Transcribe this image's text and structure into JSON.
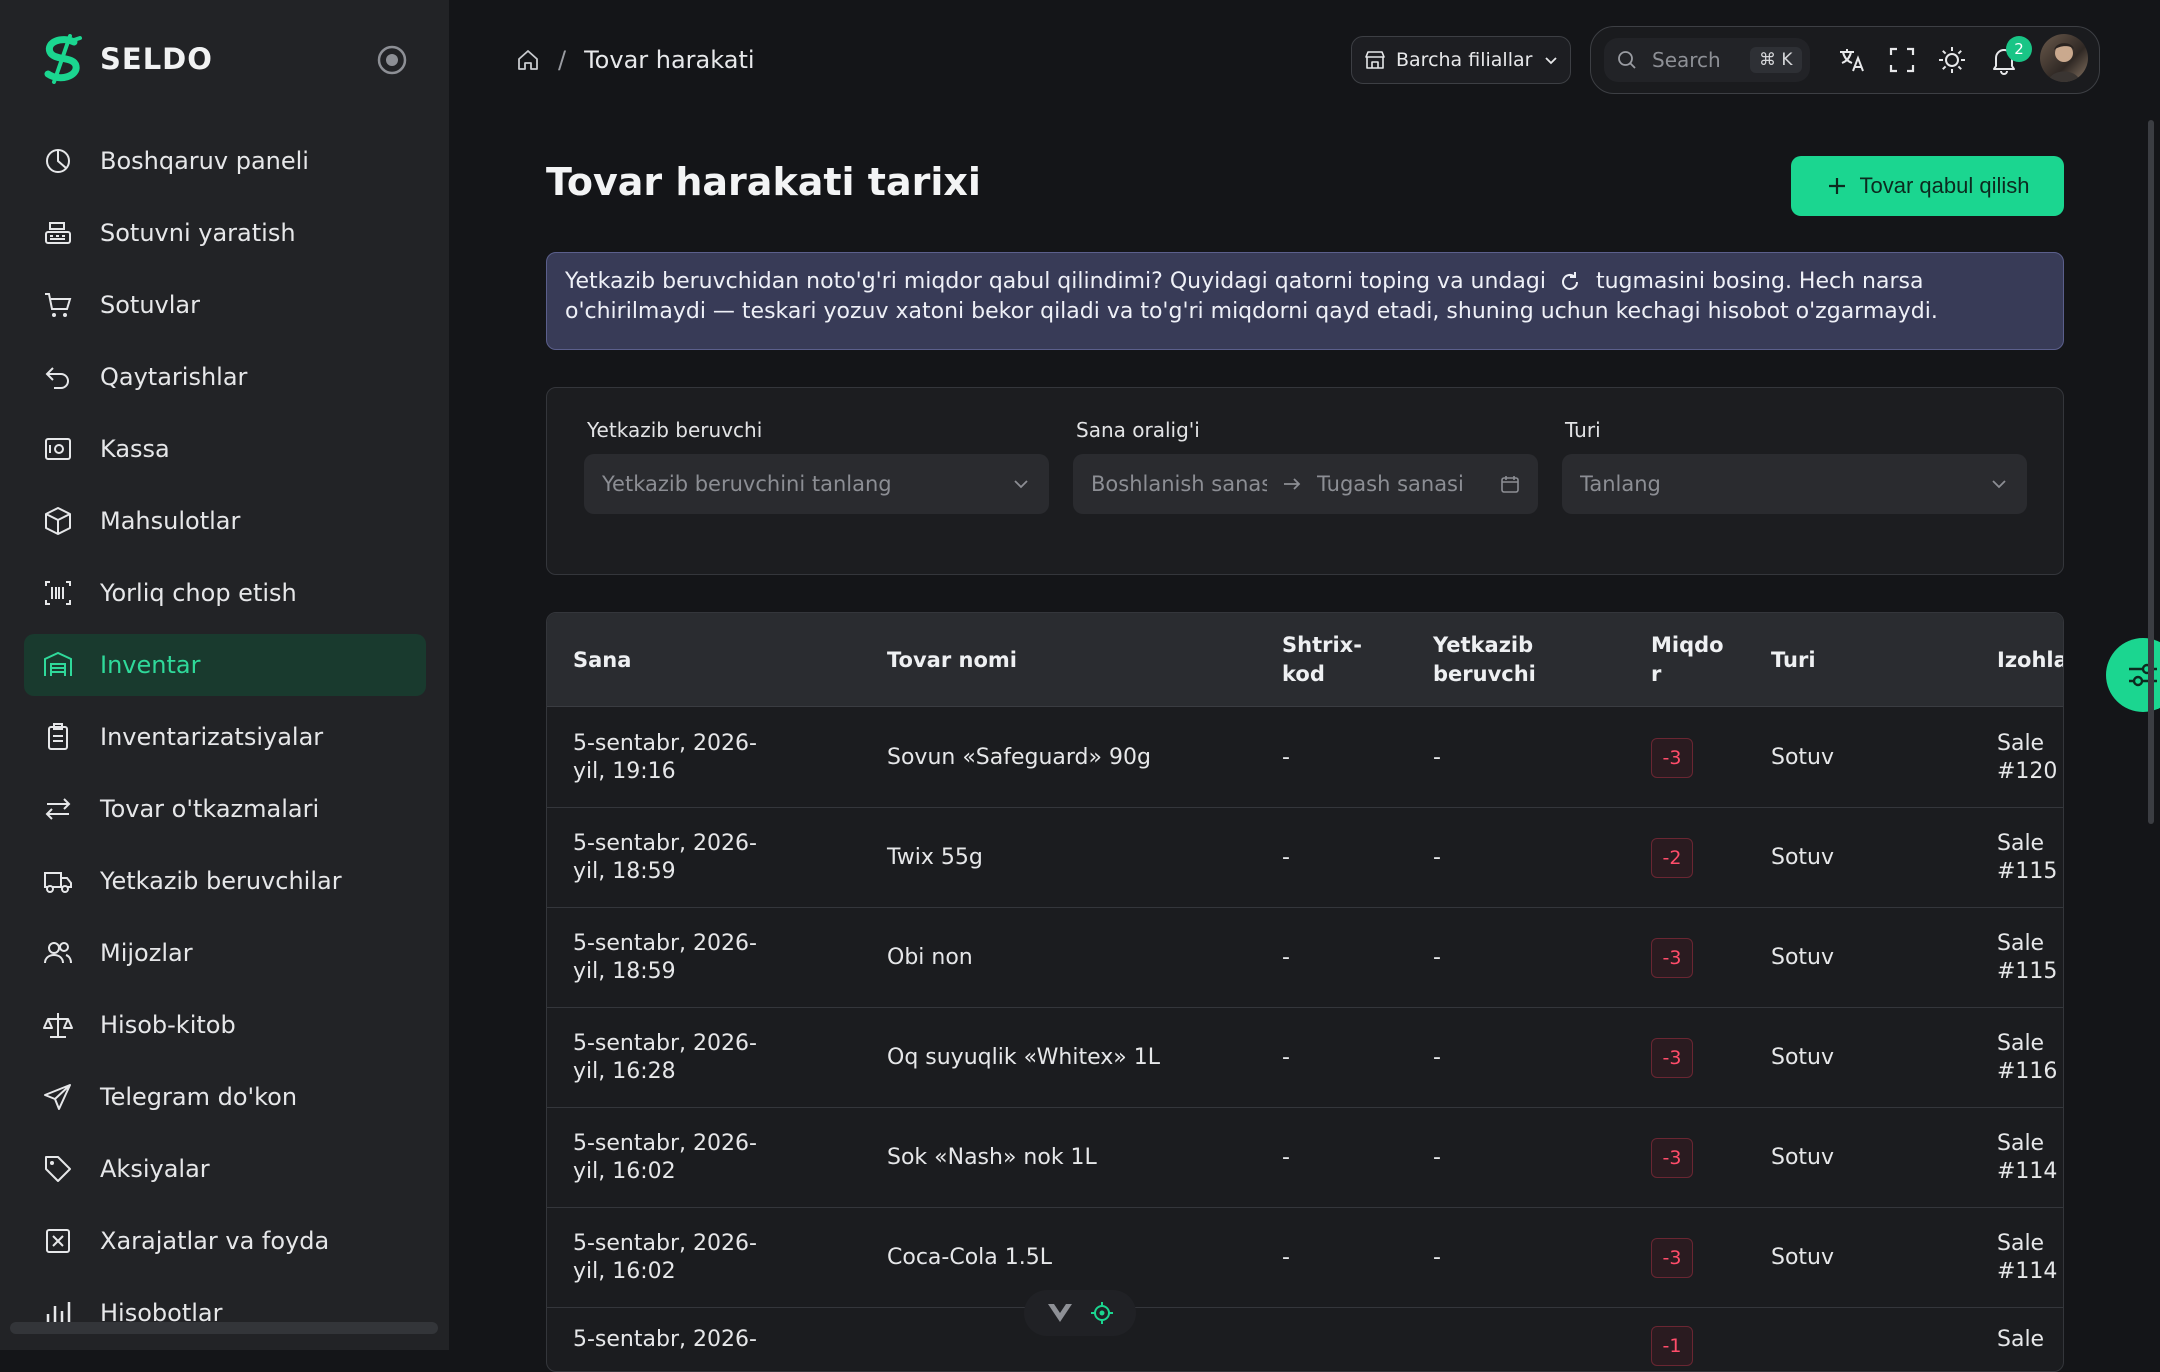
{
  "app": {
    "name": "SELDO"
  },
  "sidebar": {
    "items": [
      {
        "label": "Boshqaruv paneli",
        "icon": "dashboard-icon",
        "active": false
      },
      {
        "label": "Sotuvni yaratish",
        "icon": "cash-register-icon",
        "active": false
      },
      {
        "label": "Sotuvlar",
        "icon": "cart-icon",
        "active": false
      },
      {
        "label": "Qaytarishlar",
        "icon": "return-icon",
        "active": false
      },
      {
        "label": "Kassa",
        "icon": "safe-icon",
        "active": false
      },
      {
        "label": "Mahsulotlar",
        "icon": "box-icon",
        "active": false
      },
      {
        "label": "Yorliq chop etish",
        "icon": "barcode-icon",
        "active": false
      },
      {
        "label": "Inventar",
        "icon": "warehouse-icon",
        "active": true
      },
      {
        "label": "Inventarizatsiyalar",
        "icon": "clipboard-icon",
        "active": false
      },
      {
        "label": "Tovar o'tkazmalari",
        "icon": "transfer-icon",
        "active": false
      },
      {
        "label": "Yetkazib beruvchilar",
        "icon": "truck-icon",
        "active": false
      },
      {
        "label": "Mijozlar",
        "icon": "users-icon",
        "active": false
      },
      {
        "label": "Hisob-kitob",
        "icon": "scales-icon",
        "active": false
      },
      {
        "label": "Telegram do'kon",
        "icon": "send-icon",
        "active": false
      },
      {
        "label": "Aksiyalar",
        "icon": "tag-icon",
        "active": false
      },
      {
        "label": "Xarajatlar va foyda",
        "icon": "expense-icon",
        "active": false
      },
      {
        "label": "Hisobotlar",
        "icon": "chart-icon",
        "active": false
      }
    ]
  },
  "header": {
    "breadcrumb_current": "Tovar harakati",
    "breadcrumb_sep": "/",
    "branch_label": "Barcha filiallar",
    "search_placeholder": "Search",
    "search_shortcut": "⌘ K",
    "notifications_count": "2"
  },
  "page": {
    "title": "Tovar harakati tarixi",
    "primary_button": "Tovar qabul qilish",
    "info_text_1": "Yetkazib beruvchidan noto'g'ri miqdor qabul qilindimi? Quyidagi qatorni toping va undagi",
    "info_text_2": "tugmasini bosing. Hech narsa o'chirilmaydi — teskari yozuv xatoni bekor qiladi va to'g'ri miqdorni qayd etadi, shuning uchun kechagi hisobot o'zgarmaydi."
  },
  "filters": {
    "supplier_label": "Yetkazib beruvchi",
    "supplier_placeholder": "Yetkazib beruvchini tanlang",
    "date_label": "Sana oralig'i",
    "date_start_placeholder": "Boshlanish sanasi",
    "date_end_placeholder": "Tugash sanasi",
    "type_label": "Turi",
    "type_placeholder": "Tanlang"
  },
  "table": {
    "columns": {
      "date": "Sana",
      "product": "Tovar nomi",
      "barcode": "Shtrix-kod",
      "supplier": "Yetkazib beruvchi",
      "qty": "Miqdor",
      "type": "Turi",
      "note": "Izohlar"
    },
    "rows": [
      {
        "date": "5-sentabr, 2026-yil, 19:16",
        "product": "Sovun «Safeguard» 90g",
        "barcode": "-",
        "supplier": "-",
        "qty": "-3",
        "type": "Sotuv",
        "note": "Sale #120"
      },
      {
        "date": "5-sentabr, 2026-yil, 18:59",
        "product": "Twix 55g",
        "barcode": "-",
        "supplier": "-",
        "qty": "-2",
        "type": "Sotuv",
        "note": "Sale #115"
      },
      {
        "date": "5-sentabr, 2026-yil, 18:59",
        "product": "Obi non",
        "barcode": "-",
        "supplier": "-",
        "qty": "-3",
        "type": "Sotuv",
        "note": "Sale #115"
      },
      {
        "date": "5-sentabr, 2026-yil, 16:28",
        "product": "Oq suyuqlik «Whitex» 1L",
        "barcode": "-",
        "supplier": "-",
        "qty": "-3",
        "type": "Sotuv",
        "note": "Sale #116"
      },
      {
        "date": "5-sentabr, 2026-yil, 16:02",
        "product": "Sok «Nash» nok 1L",
        "barcode": "-",
        "supplier": "-",
        "qty": "-3",
        "type": "Sotuv",
        "note": "Sale #114"
      },
      {
        "date": "5-sentabr, 2026-yil, 16:02",
        "product": "Coca-Cola 1.5L",
        "barcode": "-",
        "supplier": "-",
        "qty": "-3",
        "type": "Sotuv",
        "note": "Sale #114"
      },
      {
        "date": "5-sentabr, 2026-",
        "product": "",
        "barcode": "",
        "supplier": "",
        "qty": "-1",
        "type": "",
        "note": "Sale"
      }
    ]
  },
  "colors": {
    "accent": "#1bd690",
    "active_nav_bg": "#193a2e",
    "negative_qty": "#ff4d6a",
    "banner_bg": "#383b57"
  }
}
